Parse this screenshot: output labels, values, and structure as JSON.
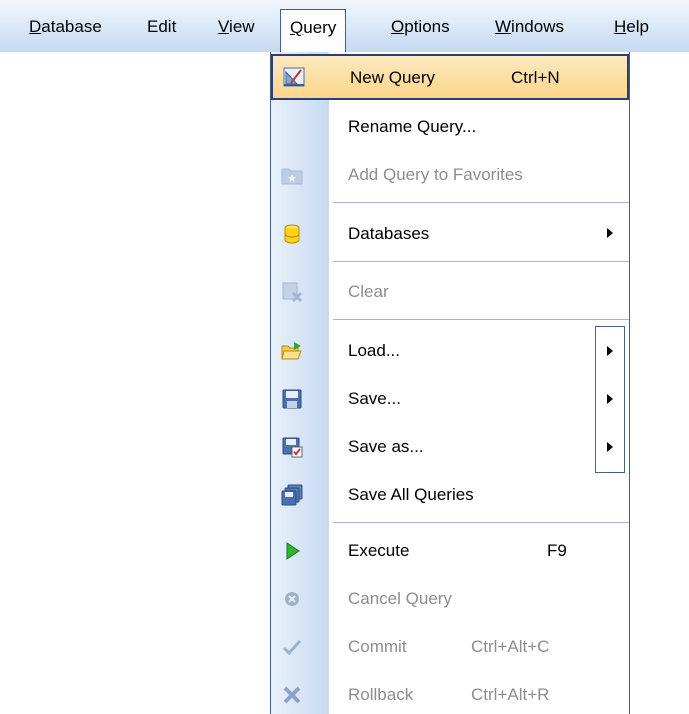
{
  "menubar": {
    "items": [
      {
        "pre": "",
        "acc": "D",
        "post": "atabase"
      },
      {
        "pre": "Edit",
        "acc": "",
        "post": ""
      },
      {
        "pre": "",
        "acc": "V",
        "post": "iew"
      },
      {
        "pre": "",
        "acc": "Q",
        "post": "uery"
      },
      {
        "pre": "",
        "acc": "O",
        "post": "ptions"
      },
      {
        "pre": "",
        "acc": "W",
        "post": "indows"
      },
      {
        "pre": "",
        "acc": "H",
        "post": "elp"
      }
    ]
  },
  "menu": {
    "items": [
      {
        "label": "New Query",
        "shortcut": "Ctrl+N",
        "icon": "new-query-icon",
        "enabled": true,
        "highlighted": true
      },
      {
        "label": "Rename Query...",
        "shortcut": "",
        "icon": "",
        "enabled": true
      },
      {
        "label": "Add Query to Favorites",
        "shortcut": "",
        "icon": "favorites-folder-icon",
        "enabled": false
      },
      {
        "label": "Databases",
        "shortcut": "",
        "icon": "database-icon",
        "enabled": true,
        "submenu": true
      },
      {
        "label": "Clear",
        "shortcut": "",
        "icon": "clear-icon",
        "enabled": false
      },
      {
        "label": "Load...",
        "shortcut": "",
        "icon": "open-folder-icon",
        "enabled": true,
        "submenu": true
      },
      {
        "label": "Save...",
        "shortcut": "",
        "icon": "save-icon",
        "enabled": true,
        "submenu": true
      },
      {
        "label": "Save as...",
        "shortcut": "",
        "icon": "save-as-icon",
        "enabled": true,
        "submenu": true
      },
      {
        "label": "Save All Queries",
        "shortcut": "",
        "icon": "save-all-icon",
        "enabled": true
      },
      {
        "label": "Execute",
        "shortcut": "F9",
        "icon": "execute-icon",
        "enabled": true
      },
      {
        "label": "Cancel Query",
        "shortcut": "",
        "icon": "cancel-icon",
        "enabled": false
      },
      {
        "label": "Commit",
        "shortcut": "Ctrl+Alt+C",
        "icon": "commit-icon",
        "enabled": false
      },
      {
        "label": "Rollback",
        "shortcut": "Ctrl+Alt+R",
        "icon": "rollback-icon",
        "enabled": false
      }
    ]
  },
  "colors": {
    "menubar_gradient": [
      "#f4f8fd",
      "#c6daf2"
    ],
    "highlight": "#fbd68b",
    "border": "#465f87",
    "disabled_text": "#8d8d8d"
  }
}
